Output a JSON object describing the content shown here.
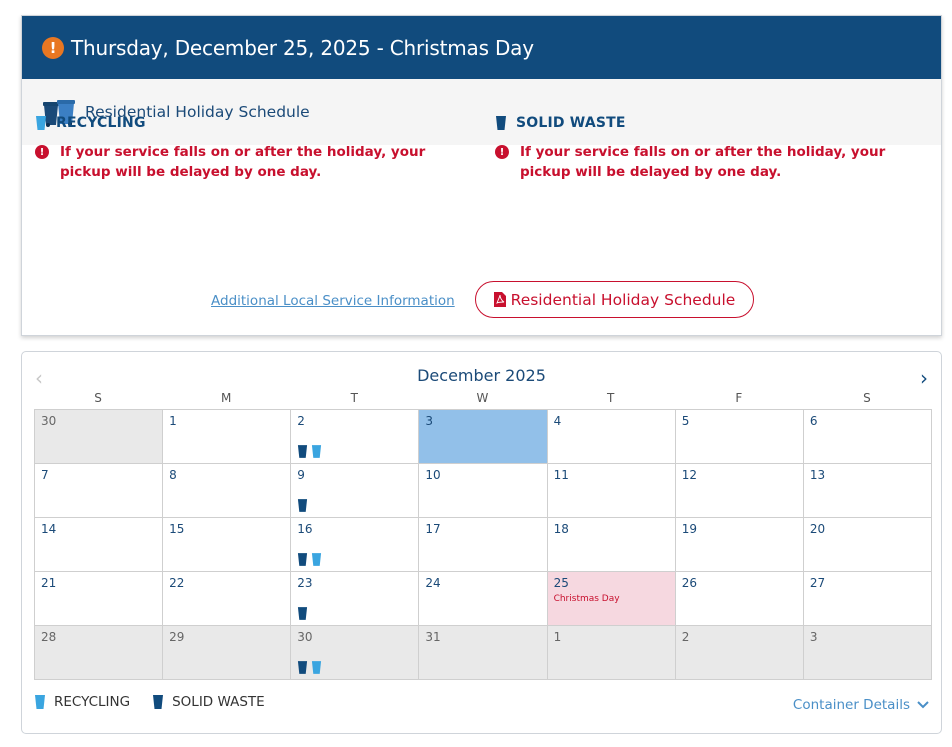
{
  "alert": {
    "title": "Thursday, December 25, 2025 - Christmas Day",
    "icon": "exclamation-circle-icon",
    "accent_color": "#114b7d"
  },
  "schedule_bar": {
    "label": "Residential Holiday Schedule",
    "icon": "bins-icon"
  },
  "services": {
    "recycling": {
      "title": "RECYCLING",
      "note": "If your service falls on or after the holiday, your pickup will be delayed by one day.",
      "color": "#3aa5e0"
    },
    "waste": {
      "title": "SOLID WASTE",
      "note": "If your service falls on or after the holiday, your pickup will be delayed by one day.",
      "color": "#114b7d"
    }
  },
  "links": {
    "local_info": "Additional Local Service Information",
    "holiday_pdf": "Residential Holiday Schedule"
  },
  "calendar": {
    "month_title": "December 2025",
    "prev_label": "‹",
    "next_label": "›",
    "weekdays": [
      "S",
      "M",
      "T",
      "W",
      "T",
      "F",
      "S"
    ],
    "days": [
      {
        "d": "30",
        "other": true
      },
      {
        "d": "1"
      },
      {
        "d": "2",
        "pickup": [
          "waste",
          "recycling"
        ]
      },
      {
        "d": "3",
        "today": true
      },
      {
        "d": "4"
      },
      {
        "d": "5"
      },
      {
        "d": "6"
      },
      {
        "d": "7"
      },
      {
        "d": "8"
      },
      {
        "d": "9",
        "pickup": [
          "waste"
        ]
      },
      {
        "d": "10"
      },
      {
        "d": "11"
      },
      {
        "d": "12"
      },
      {
        "d": "13"
      },
      {
        "d": "14"
      },
      {
        "d": "15"
      },
      {
        "d": "16",
        "pickup": [
          "waste",
          "recycling"
        ]
      },
      {
        "d": "17"
      },
      {
        "d": "18"
      },
      {
        "d": "19"
      },
      {
        "d": "20"
      },
      {
        "d": "21"
      },
      {
        "d": "22"
      },
      {
        "d": "23",
        "pickup": [
          "waste"
        ]
      },
      {
        "d": "24"
      },
      {
        "d": "25",
        "holiday": "Christmas Day"
      },
      {
        "d": "26"
      },
      {
        "d": "27"
      },
      {
        "d": "28",
        "other": true
      },
      {
        "d": "29",
        "other": true
      },
      {
        "d": "30",
        "other": true,
        "pickup": [
          "waste",
          "recycling"
        ]
      },
      {
        "d": "31",
        "other": true
      },
      {
        "d": "1",
        "other": true
      },
      {
        "d": "2",
        "other": true
      },
      {
        "d": "3",
        "other": true
      }
    ],
    "today_color": "#92c0e9",
    "holiday_color": "#f6d8e0"
  },
  "legend": {
    "recycling": "RECYCLING",
    "waste": "SOLID WASTE"
  },
  "container_details": "Container Details"
}
